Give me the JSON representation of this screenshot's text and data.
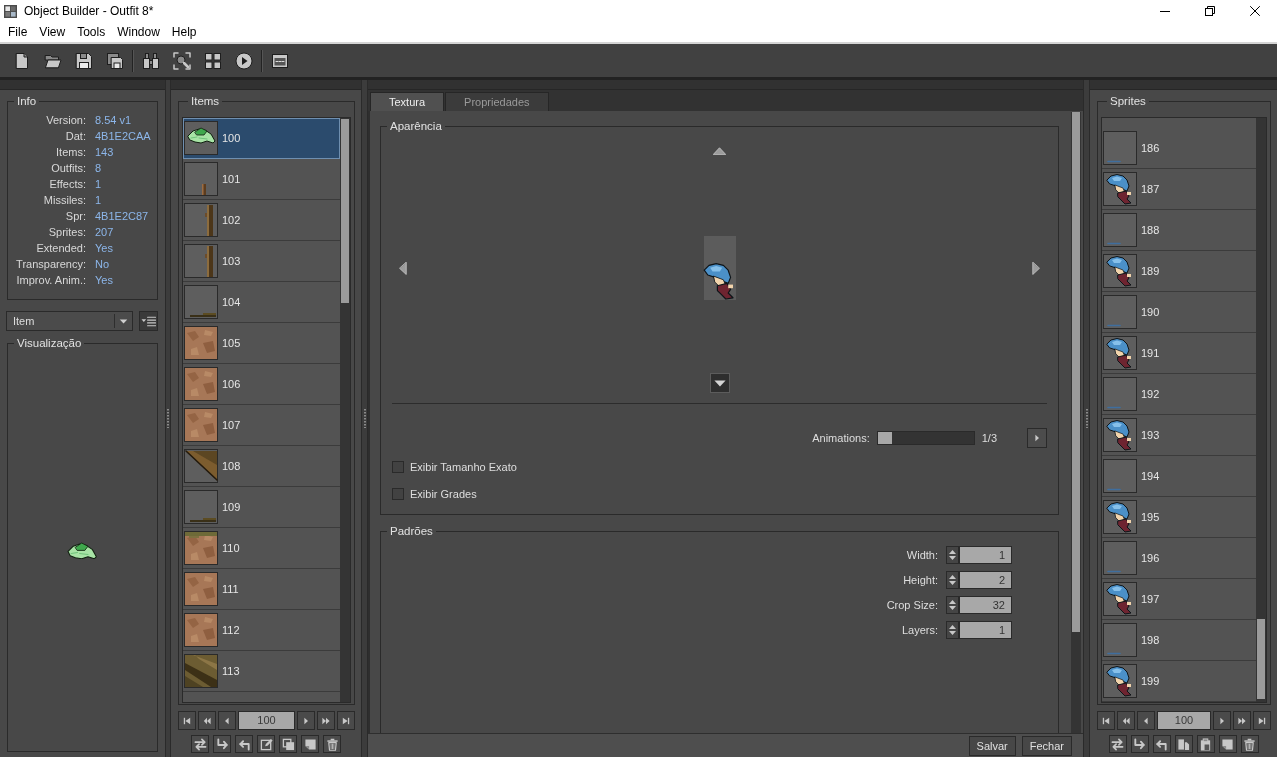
{
  "window": {
    "title": "Object Builder - Outfit 8*"
  },
  "menu": [
    {
      "label": "File"
    },
    {
      "label": "View"
    },
    {
      "label": "Tools"
    },
    {
      "label": "Window"
    },
    {
      "label": "Help"
    }
  ],
  "info": {
    "title": "Info",
    "rows": [
      {
        "label": "Version:",
        "value": "8.54 v1"
      },
      {
        "label": "Dat:",
        "value": "4B1E2CAA"
      },
      {
        "label": "Items:",
        "value": "143"
      },
      {
        "label": "Outfits:",
        "value": "8"
      },
      {
        "label": "Effects:",
        "value": "1"
      },
      {
        "label": "Missiles:",
        "value": "1"
      },
      {
        "label": "Spr:",
        "value": "4B1E2C87"
      },
      {
        "label": "Sprites:",
        "value": "207"
      },
      {
        "label": "Extended:",
        "value": "Yes"
      },
      {
        "label": "Transparency:",
        "value": "No"
      },
      {
        "label": "Improv. Anim.:",
        "value": "Yes"
      }
    ]
  },
  "category": {
    "value": "Item"
  },
  "preview": {
    "title": "Visualização",
    "kind": "leaf"
  },
  "items": {
    "title": "Items",
    "rows": [
      {
        "label": "100",
        "kind": "leaf",
        "selected": true
      },
      {
        "label": "101",
        "kind": "stump",
        "selected": false
      },
      {
        "label": "102",
        "kind": "post",
        "selected": false
      },
      {
        "label": "103",
        "kind": "post",
        "selected": false
      },
      {
        "label": "104",
        "kind": "ledge",
        "selected": false
      },
      {
        "label": "105",
        "kind": "ground",
        "selected": false
      },
      {
        "label": "106",
        "kind": "ground",
        "selected": false
      },
      {
        "label": "107",
        "kind": "ground",
        "selected": false
      },
      {
        "label": "108",
        "kind": "slope",
        "selected": false
      },
      {
        "label": "109",
        "kind": "ledge",
        "selected": false
      },
      {
        "label": "110",
        "kind": "grass-ground",
        "selected": false
      },
      {
        "label": "111",
        "kind": "ground",
        "selected": false
      },
      {
        "label": "112",
        "kind": "ground",
        "selected": false
      },
      {
        "label": "113",
        "kind": "rock-slope",
        "selected": false
      }
    ],
    "page": "100"
  },
  "tabs": [
    {
      "label": "Textura",
      "selected": true
    },
    {
      "label": "Propriedades",
      "selected": false
    }
  ],
  "appearance": {
    "title": "Aparência",
    "kind": "character",
    "directions": [
      {
        "kind": "up",
        "selected": false
      },
      {
        "kind": "left",
        "selected": false
      },
      {
        "kind": "right",
        "selected": false
      },
      {
        "kind": "down",
        "selected": true
      }
    ],
    "animations": {
      "label": "Animations:",
      "level": 0,
      "reading": "1/3"
    },
    "options": [
      {
        "label": "Exibir Tamanho Exato",
        "checked": false
      },
      {
        "label": "Exibir Grades",
        "checked": false
      }
    ]
  },
  "patterns": {
    "title": "Padrões",
    "fields": [
      {
        "label": "Width:",
        "value": "1"
      },
      {
        "label": "Height:",
        "value": "2"
      },
      {
        "label": "Crop Size:",
        "value": "32"
      },
      {
        "label": "Layers:",
        "value": "1"
      }
    ]
  },
  "buttons": [
    {
      "label": "Salvar"
    },
    {
      "label": "Fechar"
    }
  ],
  "sprites": {
    "title": "Sprites",
    "rows": [
      {
        "label": "186",
        "kind": "shadow",
        "selected": false
      },
      {
        "label": "187",
        "kind": "character",
        "selected": false
      },
      {
        "label": "188",
        "kind": "shadow",
        "selected": false
      },
      {
        "label": "189",
        "kind": "character",
        "selected": false
      },
      {
        "label": "190",
        "kind": "shadow",
        "selected": false
      },
      {
        "label": "191",
        "kind": "character",
        "selected": false
      },
      {
        "label": "192",
        "kind": "shadow",
        "selected": false
      },
      {
        "label": "193",
        "kind": "character",
        "selected": false
      },
      {
        "label": "194",
        "kind": "shadow",
        "selected": false
      },
      {
        "label": "195",
        "kind": "character",
        "selected": false
      },
      {
        "label": "196",
        "kind": "shadow",
        "selected": false
      },
      {
        "label": "197",
        "kind": "character",
        "selected": false
      },
      {
        "label": "198",
        "kind": "shadow",
        "selected": false
      },
      {
        "label": "199",
        "kind": "character",
        "selected": false
      }
    ],
    "page": "100"
  }
}
